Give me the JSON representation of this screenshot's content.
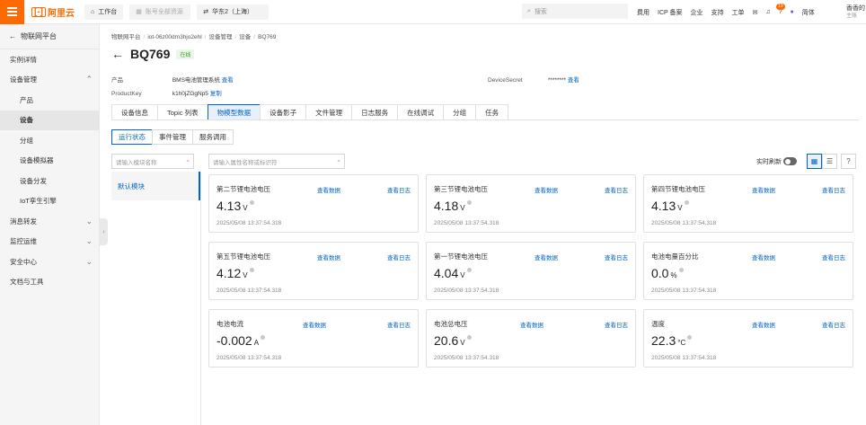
{
  "topbar": {
    "logo_text": "阿里云",
    "workbench": "工作台",
    "resources": "账号全部资源",
    "region": "华东2（上海）",
    "search_placeholder": "搜索",
    "links": [
      "费用",
      "ICP 备案",
      "企业",
      "支持",
      "工单"
    ],
    "badge_count": "13",
    "lang": "简体",
    "user_name": "香香的",
    "user_sub": "主账"
  },
  "sidebar": {
    "back_label": "物联网平台",
    "items": [
      {
        "label": "实例详情",
        "level": 1,
        "chevron": ""
      },
      {
        "label": "设备管理",
        "level": 1,
        "chevron": "⌃"
      },
      {
        "label": "产品",
        "level": 2,
        "chevron": ""
      },
      {
        "label": "设备",
        "level": 2,
        "chevron": "",
        "active": true
      },
      {
        "label": "分组",
        "level": 2,
        "chevron": ""
      },
      {
        "label": "设备模拟器",
        "level": 2,
        "chevron": ""
      },
      {
        "label": "设备分发",
        "level": 2,
        "chevron": ""
      },
      {
        "label": "IoT孪生引擎",
        "level": 2,
        "chevron": ""
      },
      {
        "label": "消息转发",
        "level": 1,
        "chevron": "⌄"
      },
      {
        "label": "监控运维",
        "level": 1,
        "chevron": "⌄"
      },
      {
        "label": "安全中心",
        "level": 1,
        "chevron": "⌄"
      },
      {
        "label": "文档与工具",
        "level": 1,
        "chevron": ""
      }
    ]
  },
  "breadcrumb": [
    "物联网平台",
    "iot-06z00dm3hjo2ehl",
    "设备管理",
    "设备",
    "BQ769"
  ],
  "device": {
    "title": "BQ769",
    "status": "在线",
    "product_label": "产品",
    "product_value": "BMS电池管理系统",
    "product_link": "查看",
    "productkey_label": "ProductKey",
    "productkey_value": "k1h0jZGgNp5",
    "copy_link": "复制",
    "secret_label": "DeviceSecret",
    "secret_value": "********",
    "secret_link": "查看"
  },
  "tabs": [
    "设备信息",
    "Topic 列表",
    "物模型数据",
    "设备影子",
    "文件管理",
    "日志服务",
    "在线调试",
    "分组",
    "任务"
  ],
  "active_tab": 2,
  "subtabs": [
    "运行状态",
    "事件管理",
    "服务调用"
  ],
  "module_search_placeholder": "请输入模块名称",
  "module_items": [
    "默认模块"
  ],
  "prop_search_placeholder": "请输入属性名称或标识符",
  "realtime_label": "实时刷新",
  "card_link_data": "查看数据",
  "card_link_log": "查看日志",
  "cards": [
    {
      "name": "第二节锂电池电压",
      "value": "4.13",
      "unit": "V",
      "time": "2025/05/08 13:37:54.318"
    },
    {
      "name": "第三节锂电池电压",
      "value": "4.18",
      "unit": "V",
      "time": "2025/05/08 13:37:54.318"
    },
    {
      "name": "第四节锂电池电压",
      "value": "4.13",
      "unit": "V",
      "time": "2025/05/08 13:37:54.318"
    },
    {
      "name": "第五节锂电池电压",
      "value": "4.12",
      "unit": "V",
      "time": "2025/05/08 13:37:54.318"
    },
    {
      "name": "第一节锂电池电压",
      "value": "4.04",
      "unit": "V",
      "time": "2025/05/08 13:37:54.318"
    },
    {
      "name": "电池电量百分比",
      "value": "0.0",
      "unit": "%",
      "time": "2025/05/08 13:37:54.318"
    },
    {
      "name": "电池电流",
      "value": "-0.002",
      "unit": "A",
      "time": "2025/05/08 13:37:54.318"
    },
    {
      "name": "电池总电压",
      "value": "20.6",
      "unit": "V",
      "time": "2025/05/08 13:37:54.318"
    },
    {
      "name": "温度",
      "value": "22.3",
      "unit": "°C",
      "time": "2025/05/08 13:37:54.318"
    }
  ],
  "colors": {
    "brand": "#ff6a00",
    "link": "#0064c8",
    "online": "#389e0d"
  }
}
